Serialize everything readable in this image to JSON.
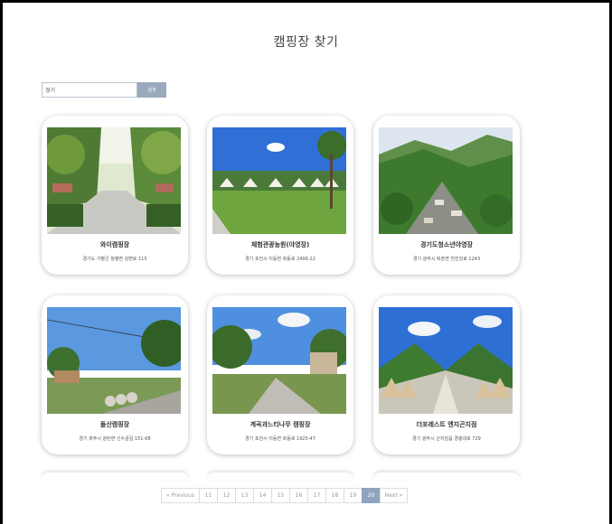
{
  "page": {
    "title": "캠핑장 찾기"
  },
  "search": {
    "value": "경기",
    "button_label": "검색"
  },
  "cards": [
    {
      "name": "와이캠핑장",
      "address": "경기도 가평군 청평면 강변로 115"
    },
    {
      "name": "체험관광농원(야영장)",
      "address": "경기 포천시 이동면 화동로 2496-22"
    },
    {
      "name": "경기도청소년야영장",
      "address": "경기 광주시 퇴촌면 천진암로 1243"
    },
    {
      "name": "돌산캠핑장",
      "address": "경기 파주시 광탄면 신수골길 151-68"
    },
    {
      "name": "계곡과느티나무 캠핑장",
      "address": "경기 포천시 이동면 화동로 1925-47"
    },
    {
      "name": "더포레스트 엔지곤지점",
      "address": "경기 광주시 곤지암읍 경충대로 729"
    }
  ],
  "pagination": {
    "prev_label": "« Previous",
    "pages": [
      "11",
      "12",
      "13",
      "14",
      "15",
      "16",
      "17",
      "18",
      "19",
      "20"
    ],
    "active": "20",
    "next_label": "Next »"
  },
  "colors": {
    "accent": "#8fa3bd",
    "search_button": "#9aa9bd",
    "border": "#000000"
  }
}
